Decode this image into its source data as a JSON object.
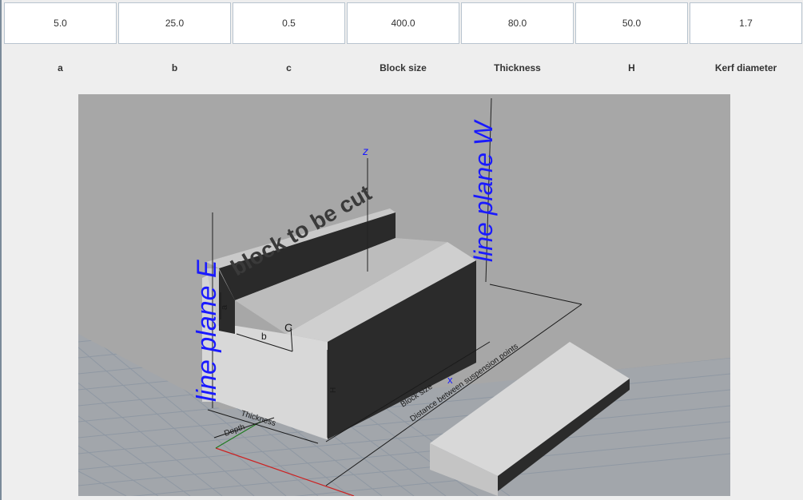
{
  "params": {
    "values": [
      "5.0",
      "25.0",
      "0.5",
      "400.0",
      "80.0",
      "50.0",
      "1.7"
    ],
    "labels": [
      "a",
      "b",
      "c",
      "Block size",
      "Thickness",
      "H",
      "Kerf diameter"
    ]
  },
  "scene": {
    "block_text": "block to be cut",
    "plane_e_label": "line plane E",
    "plane_w_label": "line plane W",
    "axis_z_label": "z",
    "axis_x_label": "x",
    "dim_a": "a",
    "dim_b": "b",
    "dim_c": "C",
    "dim_h": "H",
    "dim_thickness": "Thickness",
    "dim_depth": "Depth",
    "dim_block_size": "Block size",
    "dim_distance": "Distance between suspension points",
    "colors": {
      "viewport_bg": "#a7a7a7",
      "plane_label": "#1a1aff",
      "block_light": "#d9d9d9",
      "block_dark": "#2b2b2b",
      "grid_line": "#8f98a3"
    }
  }
}
